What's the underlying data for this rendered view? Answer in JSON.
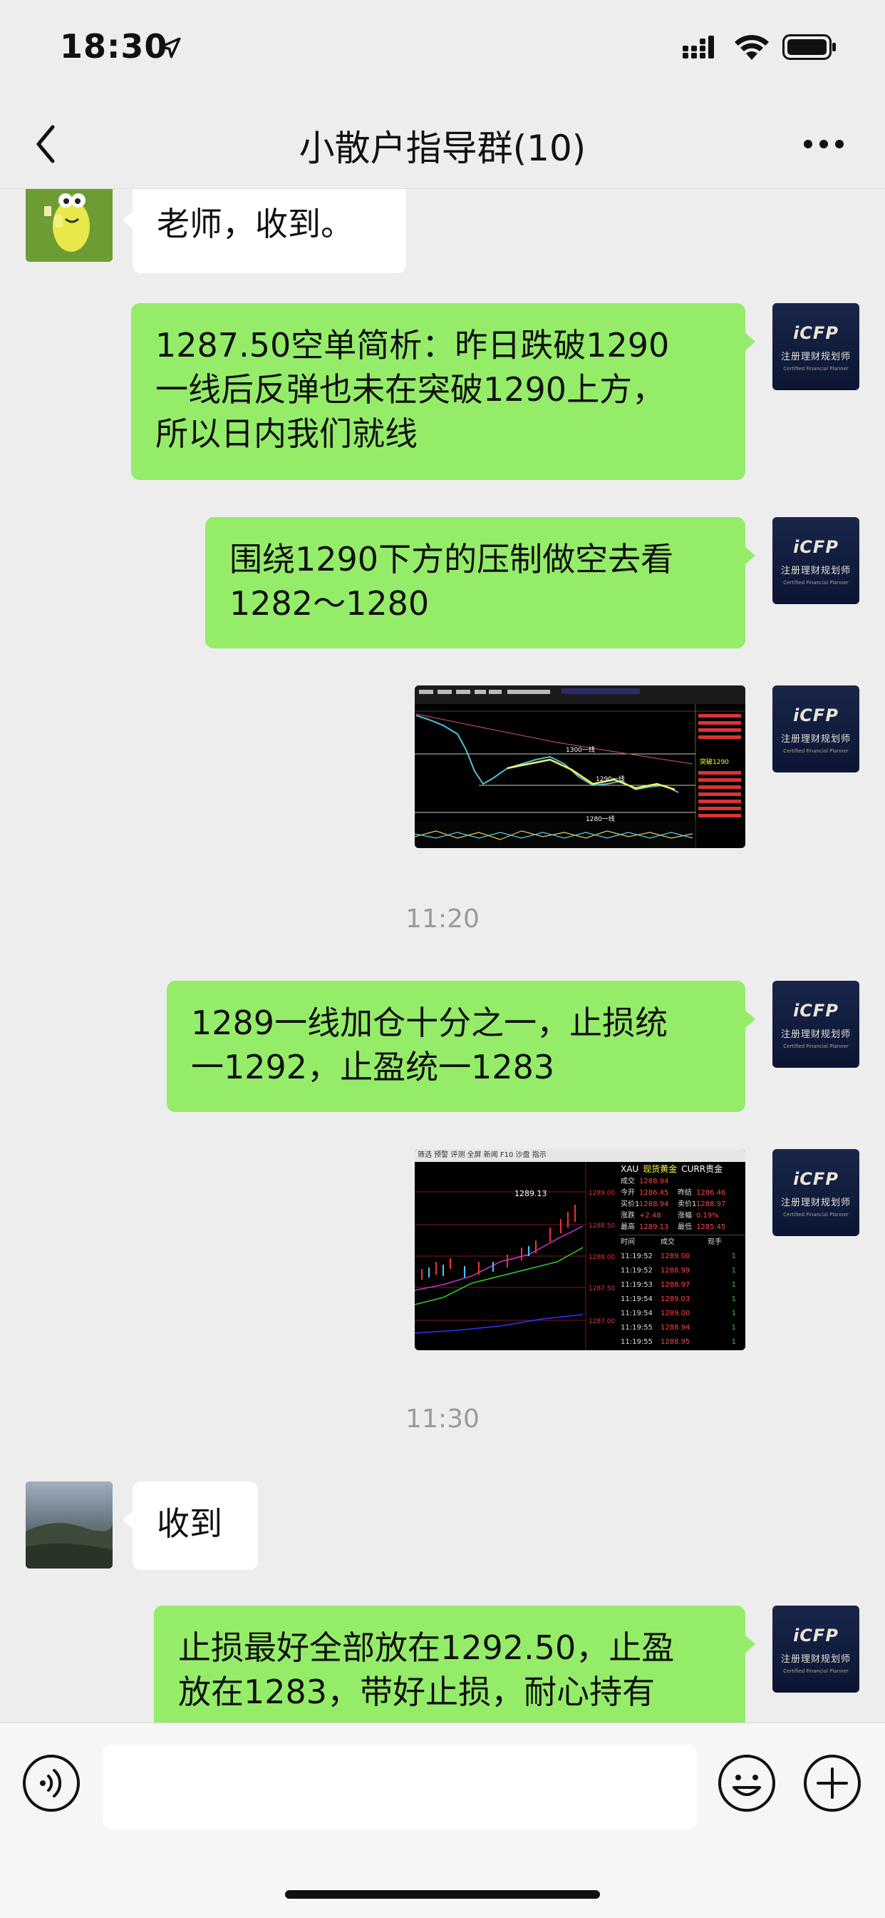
{
  "status_bar": {
    "time": "18:30"
  },
  "nav": {
    "title": "小散户指导群(10)"
  },
  "avatar_icfp": {
    "logo": "iCFP",
    "cn": "注册理财规划师",
    "en": "Certified Financial Planner"
  },
  "messages": [
    {
      "text": "老师，收到。"
    },
    {
      "lines": [
        "1287.50空单简析：昨日跌破1290",
        "一线后反弹也未在突破1290上方，",
        "所以日内我们就线"
      ]
    },
    {
      "lines": [
        "围绕1290下方的压制做空去看",
        "1282～1280"
      ]
    },
    {
      "chart_labels": [
        "1300一线",
        "1290一线",
        "1280一线",
        "突破1290"
      ]
    },
    {
      "timestamp": "11:20"
    },
    {
      "lines": [
        "1289一线加仓十分之一，止损统",
        "一1292，止盈统一1283"
      ]
    },
    {
      "chart2": {
        "menu": "筛选  预警  评测  全屏  新闻  F10  沙盘  指示",
        "peak": "1289.13",
        "y_ticks": [
          "1289.00",
          "1288.50",
          "1288.00",
          "1287.50",
          "1287.00"
        ],
        "header": [
          "XAU",
          "现货黄金",
          "CURR贵金"
        ],
        "quote_rows": [
          [
            "成交",
            "1288.94",
            "",
            ""
          ],
          [
            "今开",
            "1286.45",
            "昨结",
            "1286.46"
          ],
          [
            "买价1",
            "1288.94",
            "卖价1",
            "1288.97"
          ],
          [
            "涨跌",
            "+2.48",
            "涨幅",
            "0.19%"
          ],
          [
            "最高",
            "1289.13",
            "最低",
            "1285.45"
          ]
        ],
        "trade_header": [
          "时间",
          "成交",
          "现手"
        ],
        "trades": [
          [
            "11:19:52",
            "1289.00",
            "1"
          ],
          [
            "11:19:52",
            "1288.99",
            "1"
          ],
          [
            "11:19:53",
            "1288.97",
            "1"
          ],
          [
            "11:19:54",
            "1289.03",
            "1"
          ],
          [
            "11:19:54",
            "1289.00",
            "1"
          ],
          [
            "11:19:55",
            "1288.94",
            "1"
          ],
          [
            "11:19:55",
            "1288.95",
            "1"
          ]
        ]
      }
    },
    {
      "timestamp": "11:30"
    },
    {
      "text": "收到"
    },
    {
      "lines": [
        "止损最好全部放在1292.50，止盈",
        "放在1283，带好止损，耐心持有"
      ]
    }
  ],
  "colors": {
    "bubble_green": "#95ec69",
    "background": "#ededed",
    "icfp_navy": "#142040"
  }
}
